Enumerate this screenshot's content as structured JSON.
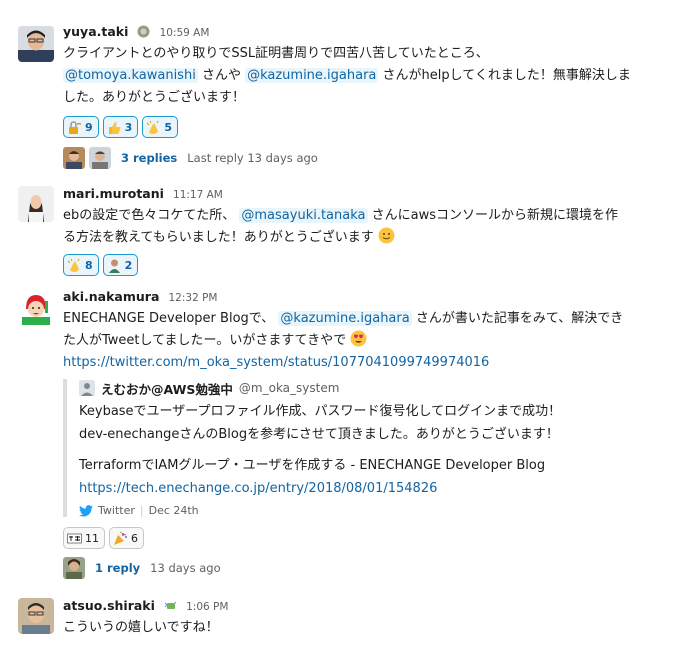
{
  "messages": [
    {
      "user": "yuya.taki",
      "time": "10:59 AM",
      "line1": "クライアントとのやり取りでSSL証明書周りで四苦八苦していたところ、",
      "mention1": "@tomoya.kawanishi",
      "mid": " さんや ",
      "mention2": "@kazumine.igahara",
      "line2_tail": " さんがhelpしてくれました！無事解決しま",
      "line3": "した。ありがとうございます！",
      "reactions": [
        {
          "emoji": "lock-key-icon",
          "count": "9"
        },
        {
          "emoji": "thumbs-up-icon",
          "count": "3"
        },
        {
          "emoji": "clap-icon",
          "count": "5"
        }
      ],
      "thread": {
        "replies": "3 replies",
        "last": "Last reply 13 days ago"
      }
    },
    {
      "user": "mari.murotani",
      "time": "11:17 AM",
      "line1_head": "ebの設定で色々コケてた所、 ",
      "mention1": "@masayuki.tanaka",
      "line1_tail": " さんにawsコンソールから新規に環境を作",
      "line2": "る方法を教えてもらいました！ありがとうございます",
      "reactions": [
        {
          "emoji": "clap-icon",
          "count": "8"
        },
        {
          "emoji": "person-icon",
          "count": "2"
        }
      ]
    },
    {
      "user": "aki.nakamura",
      "time": "12:32 PM",
      "line1_head": "ENECHANGE Developer Blogで、 ",
      "mention1": "@kazumine.igahara",
      "line1_tail": " さんが書いた記事をみて、解決でき",
      "line2": "た人がTweetしてましたー。いがさますてきやで",
      "url": "https://twitter.com/m_oka_system/status/1077041099749974016",
      "attachment": {
        "author": "えむおか@AWS勉強中",
        "handle": "@m_oka_system",
        "text1": "Keybaseでユーザープロファイル作成、パスワード復号化してログインまで成功！",
        "text2": "dev-enechangeさんのBlogを参考にさせて頂きました。ありがとうございます！",
        "text3": "TerraformでIAMグループ・ユーザを作成する - ENECHANGE Developer Blog",
        "link": "https://tech.enechange.co.jp/entry/2018/08/01/154826",
        "source": "Twitter",
        "date": "Dec 24th"
      },
      "reactions": [
        {
          "emoji": "suteki-icon",
          "count": "11"
        },
        {
          "emoji": "party-popper-icon",
          "count": "6"
        }
      ],
      "thread": {
        "replies": "1 reply",
        "last": "13 days ago"
      }
    },
    {
      "user": "atsuo.shiraki",
      "time": "1:06 PM",
      "line1": "こういうの嬉しいですね！"
    }
  ],
  "colors": {
    "link": "#1264a3",
    "mention_bg": "#e8f5fa",
    "twitter": "#1da1f2"
  }
}
